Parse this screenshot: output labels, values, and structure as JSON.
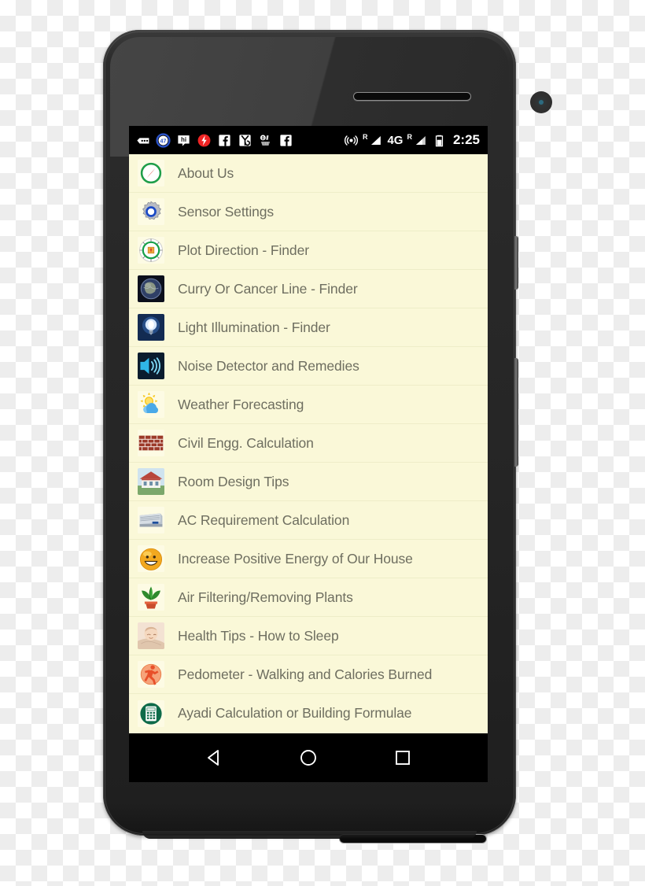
{
  "device": {
    "type": "android-smartphone",
    "earpiece": "earpiece-speaker",
    "front_camera": "front-camera",
    "bottom_speaker": "bottom-speaker",
    "power_button": "power-button",
    "volume_button": "volume-rocker"
  },
  "status_bar": {
    "background_color": "#000000",
    "clock": "2:25",
    "network_label": "4G",
    "roaming_label": "R",
    "left_icons": [
      "messages-icon",
      "notification-count-47-icon",
      "hike-messenger-icon",
      "flash-alert-icon",
      "facebook-icon",
      "share-it-icon",
      "cleaner-icon",
      "facebook-icon"
    ],
    "right_icons": [
      "hotspot-icon",
      "signal-bars-sim1-icon",
      "network-4g-icon",
      "signal-bars-sim2-icon",
      "battery-icon"
    ]
  },
  "list": {
    "background_color": "#faf8d8",
    "text_color": "#6e6e60",
    "divider_color": "#eeedc8",
    "items": [
      {
        "label": "About Us",
        "icon": "compass-icon"
      },
      {
        "label": "Sensor Settings",
        "icon": "gear-settings-icon"
      },
      {
        "label": "Plot Direction - Finder",
        "icon": "compass-rose-icon"
      },
      {
        "label": "Curry Or Cancer Line - Finder",
        "icon": "globe-icon"
      },
      {
        "label": "Light Illumination - Finder",
        "icon": "lightbulb-icon"
      },
      {
        "label": "Noise Detector and Remedies",
        "icon": "sound-wave-icon"
      },
      {
        "label": "Weather Forecasting",
        "icon": "sun-cloud-icon"
      },
      {
        "label": "Civil Engg. Calculation",
        "icon": "brick-wall-icon"
      },
      {
        "label": "Room Design Tips",
        "icon": "house-icon"
      },
      {
        "label": "AC Requirement Calculation",
        "icon": "air-conditioner-icon"
      },
      {
        "label": "Increase Positive Energy of Our House",
        "icon": "smiley-face-icon"
      },
      {
        "label": "Air Filtering/Removing Plants",
        "icon": "potted-plant-icon"
      },
      {
        "label": "Health Tips - How to Sleep",
        "icon": "sleeping-baby-icon"
      },
      {
        "label": "Pedometer - Walking and Calories Burned",
        "icon": "running-person-icon"
      },
      {
        "label": "Ayadi Calculation or Building Formulae",
        "icon": "calculator-icon"
      }
    ]
  },
  "nav_bar": {
    "background_color": "#000000",
    "buttons": [
      {
        "name": "back-button",
        "icon": "back-triangle-icon"
      },
      {
        "name": "home-button",
        "icon": "home-circle-icon"
      },
      {
        "name": "recents-button",
        "icon": "recents-square-icon"
      }
    ]
  }
}
